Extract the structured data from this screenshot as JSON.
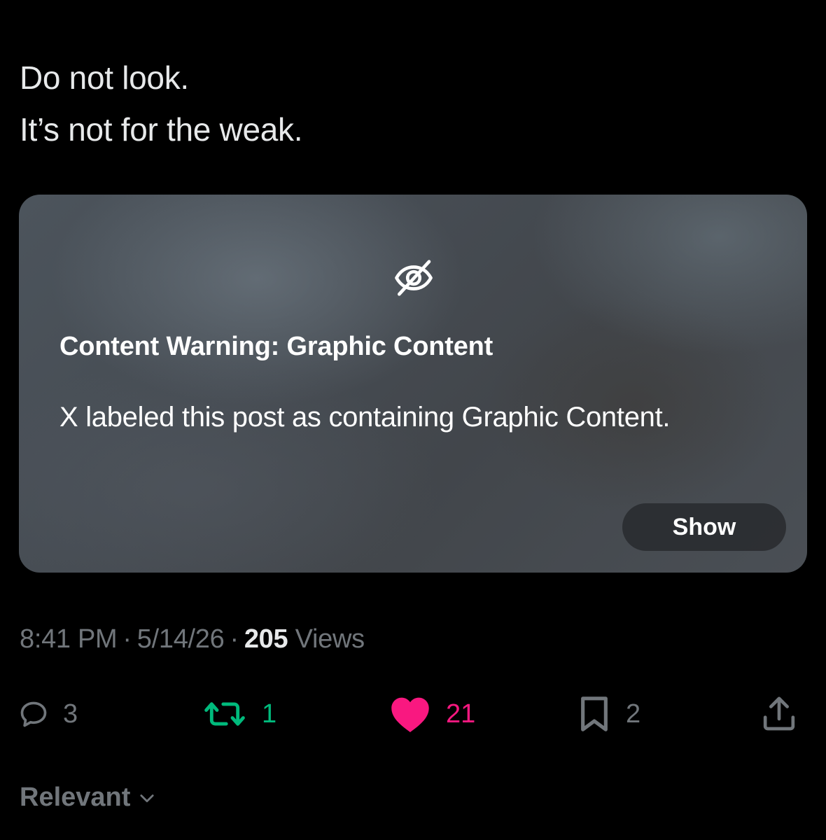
{
  "post": {
    "text_lines": [
      "Do not look.",
      "It’s not for the weak."
    ]
  },
  "media_warning": {
    "icon": "eye-slash-icon",
    "title": "Content Warning: Graphic Content",
    "description": "X labeled this post as containing Graphic Content.",
    "show_label": "Show"
  },
  "meta": {
    "time": "8:41 PM",
    "separator": "·",
    "date": "5/14/26",
    "views_count": "205",
    "views_label": "Views"
  },
  "actions": {
    "reply": {
      "icon": "reply-icon",
      "count": "3"
    },
    "repost": {
      "icon": "repost-icon",
      "count": "1"
    },
    "like": {
      "icon": "heart-icon",
      "count": "21"
    },
    "bookmark": {
      "icon": "bookmark-icon",
      "count": "2"
    },
    "share": {
      "icon": "share-icon"
    }
  },
  "replies_sort": {
    "label": "Relevant",
    "icon": "chevron-down-icon"
  },
  "colors": {
    "background": "#000000",
    "text": "#e7e9ea",
    "muted": "#71767b",
    "repost_active": "#00ba7c",
    "like_active": "#f91880"
  }
}
